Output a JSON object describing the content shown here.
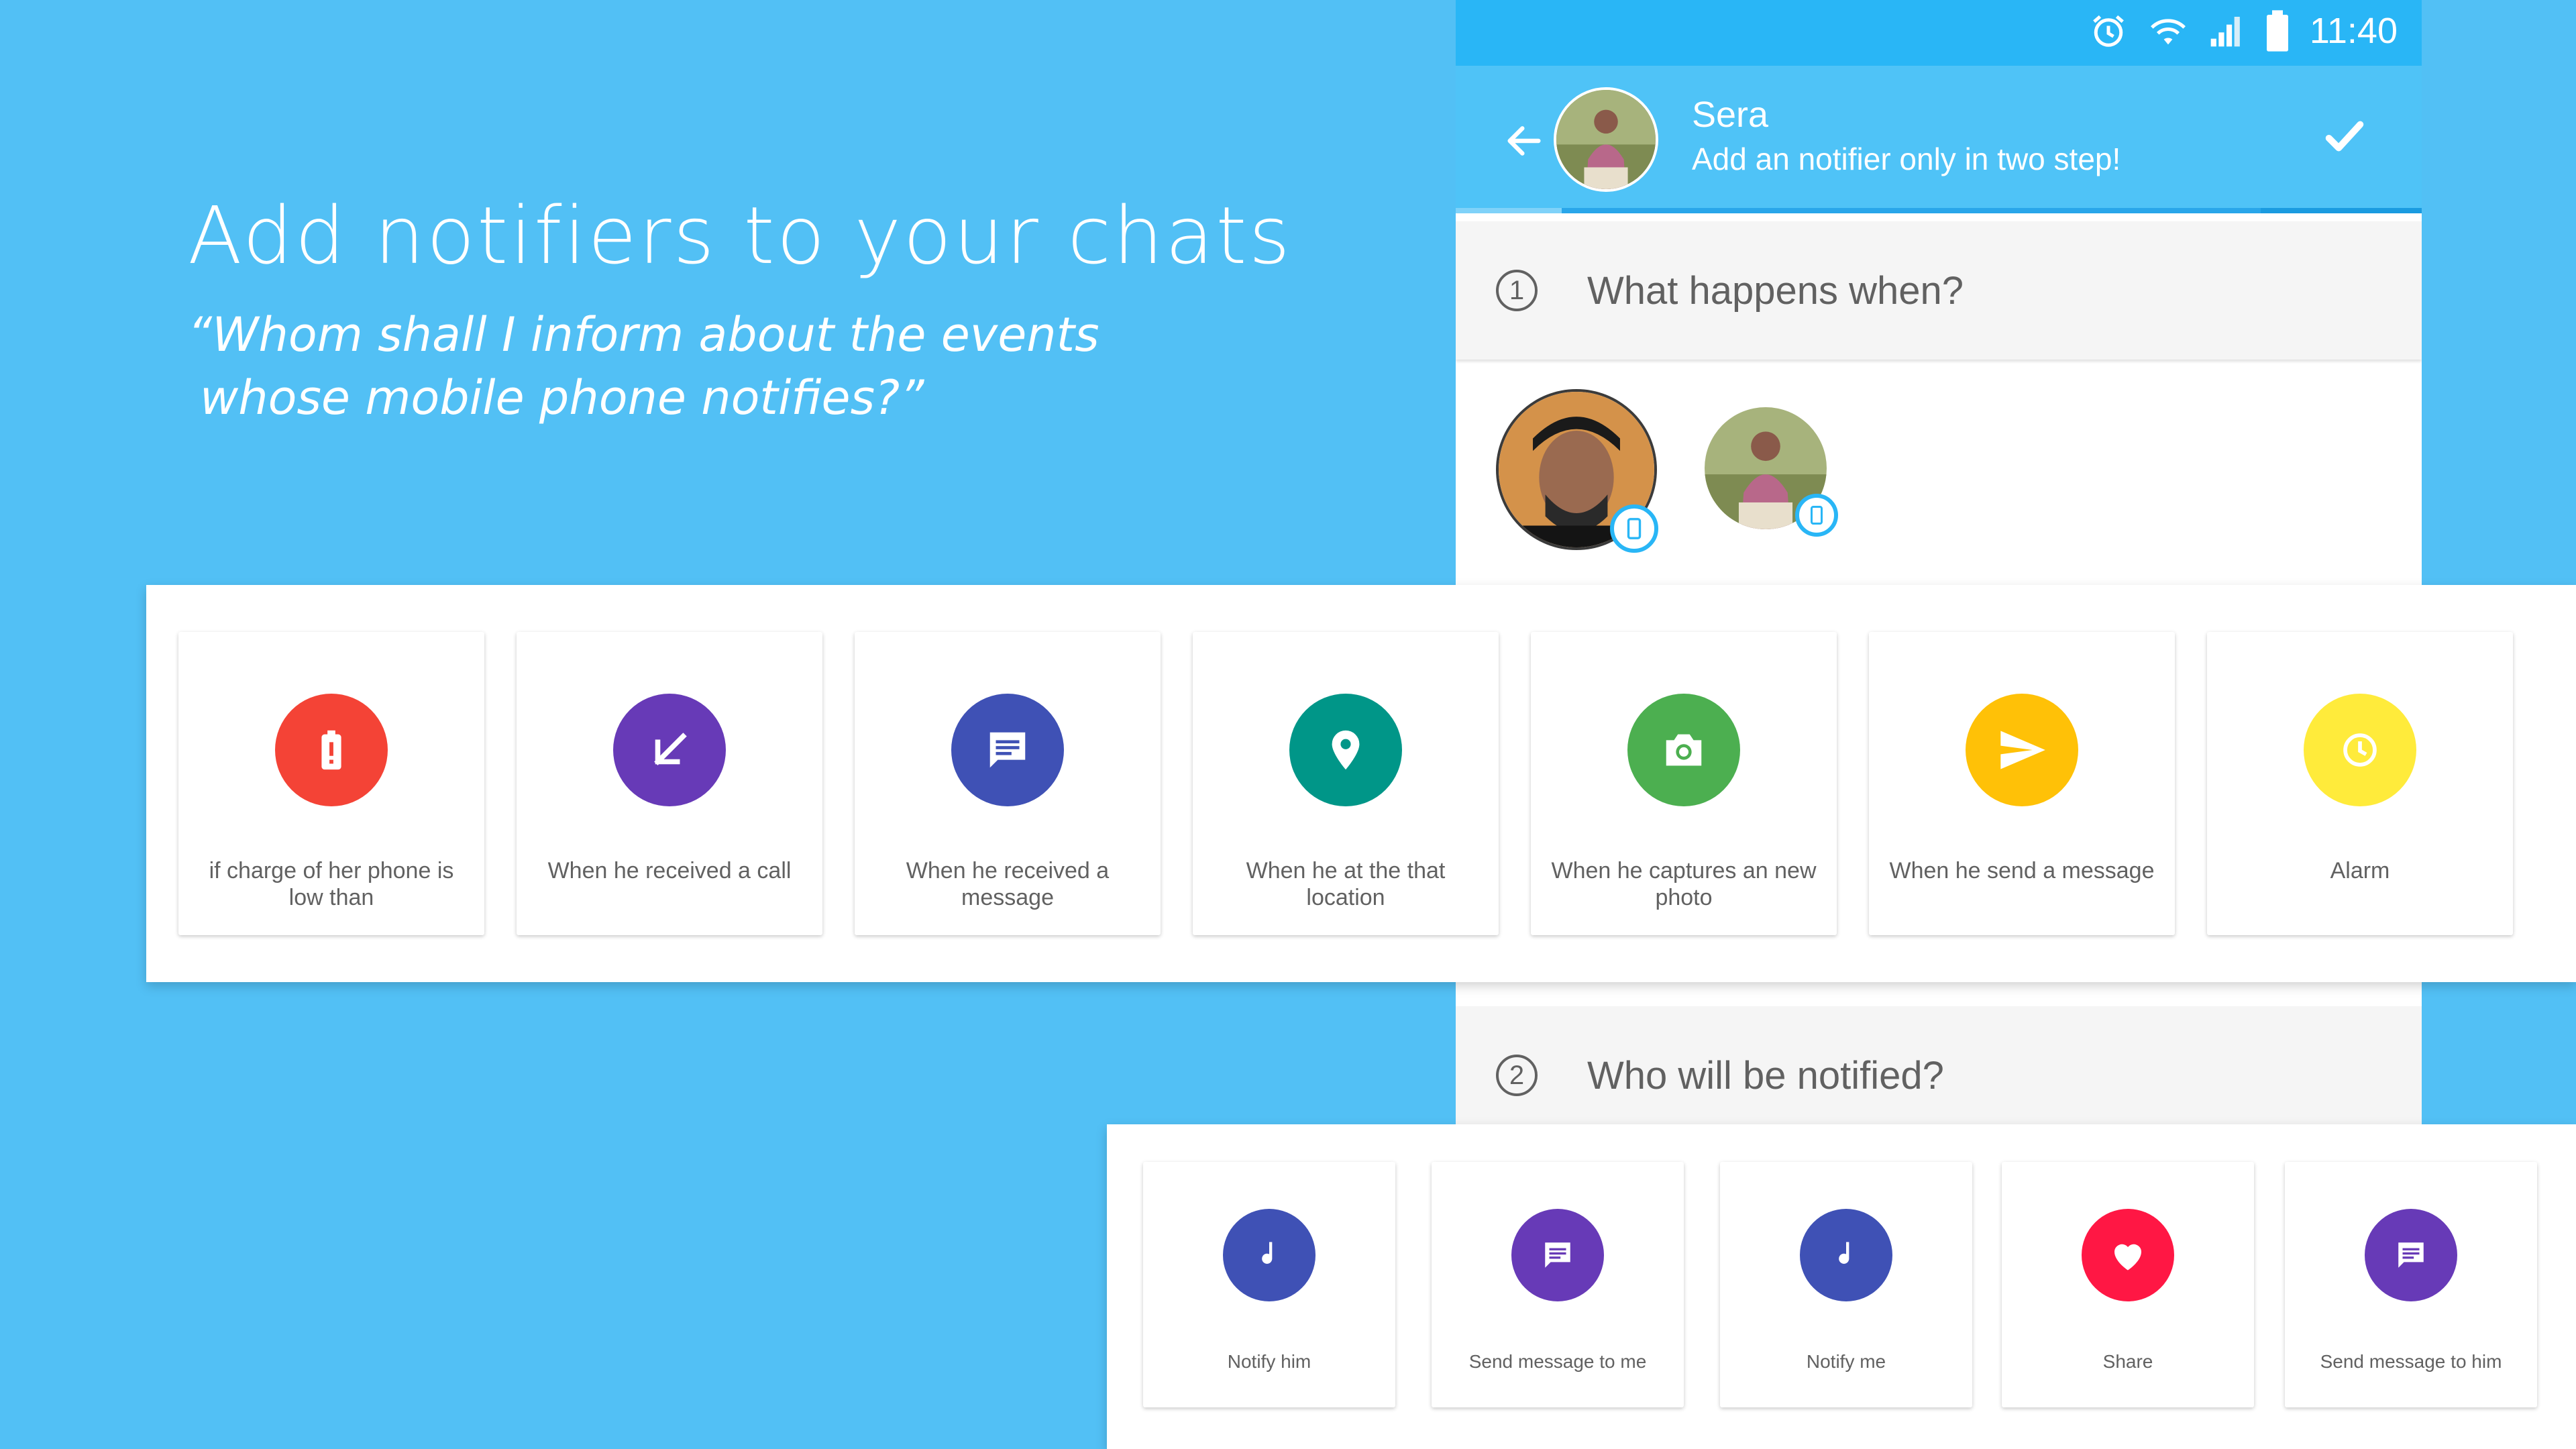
{
  "promo": {
    "headline": "Add notifiers to your chats",
    "quote_line1": "“Whom shall I inform about the events",
    "quote_line2": "whose mobile phone notifies?”"
  },
  "status_bar": {
    "time": "11:40",
    "icons": [
      "alarm-icon",
      "wifi-icon",
      "signal-icon",
      "battery-icon"
    ]
  },
  "app_bar": {
    "contact_name": "Sera",
    "subtitle": "Add an notifier only in two step!",
    "back_icon": "arrow-back-icon",
    "confirm_icon": "check-icon"
  },
  "steps": [
    {
      "number": "1",
      "title": "What happens when?"
    },
    {
      "number": "2",
      "title": "Who will be notified?"
    }
  ],
  "people": [
    {
      "name": "person-1",
      "badge_icon": "smartphone-icon"
    },
    {
      "name": "person-2",
      "badge_icon": "smartphone-icon"
    }
  ],
  "triggers": [
    {
      "label": "if charge of her phone is low than",
      "icon": "battery-alert-icon",
      "color": "#f44336"
    },
    {
      "label": "When he received a call",
      "icon": "call-received-icon",
      "color": "#673ab7"
    },
    {
      "label": "When he received a message",
      "icon": "message-icon",
      "color": "#3f51b5"
    },
    {
      "label": "When he at the that location",
      "icon": "location-pin-icon",
      "color": "#009688"
    },
    {
      "label": "When he captures an new photo",
      "icon": "camera-icon",
      "color": "#4caf50"
    },
    {
      "label": "When he send a message",
      "icon": "send-icon",
      "color": "#ffc107"
    },
    {
      "label": "Alarm",
      "icon": "alarm-icon",
      "color": "#ffeb3b"
    }
  ],
  "actions": [
    {
      "label": "Notify him",
      "icon": "music-note-icon",
      "color": "#3f51b5"
    },
    {
      "label": "Send message to me",
      "icon": "message-icon",
      "color": "#673ab7"
    },
    {
      "label": "Notify me",
      "icon": "music-note-icon",
      "color": "#3f51b5"
    },
    {
      "label": "Share",
      "icon": "heart-icon",
      "color": "#ff1744"
    },
    {
      "label": "Send message to him",
      "icon": "message-icon",
      "color": "#673ab7"
    }
  ]
}
